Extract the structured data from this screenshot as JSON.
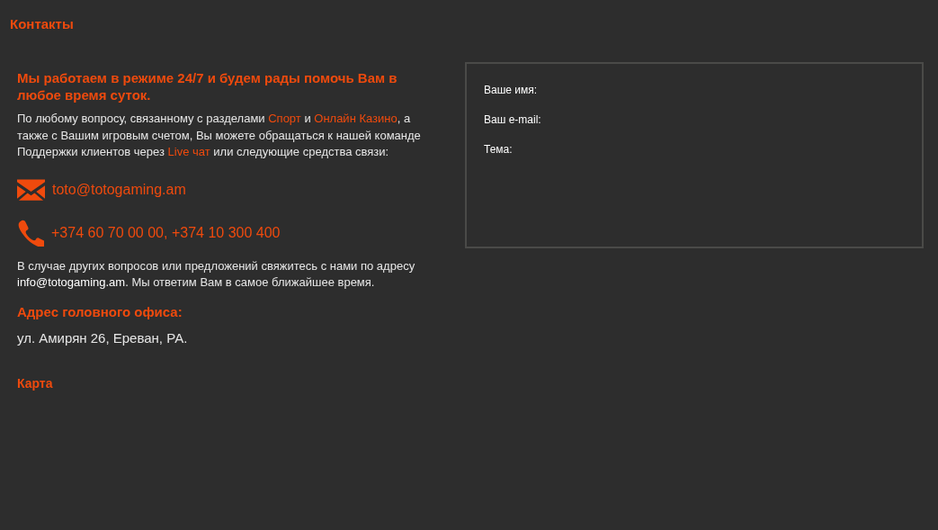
{
  "page_title": "Контакты",
  "headline": "Мы работаем в режиме 24/7 и будем рады помочь Вам в любое время суток.",
  "intro": [
    {
      "kind": "text",
      "text": "По любому вопросу, связанному с разделами "
    },
    {
      "kind": "link",
      "text": "Спорт"
    },
    {
      "kind": "text",
      "text": " и "
    },
    {
      "kind": "link",
      "text": "Онлайн Казино"
    },
    {
      "kind": "text",
      "text": ", а также с Вашим игровым счетом, Вы можете обращаться к нашей команде Поддержки клиентов через "
    },
    {
      "kind": "link",
      "text": "Live чат"
    },
    {
      "kind": "text",
      "text": " или следующие средства связи:"
    }
  ],
  "contacts": [
    {
      "kind": "email",
      "text": "toto@totogaming.am"
    },
    {
      "kind": "phone",
      "text": "+374 60 70 00 00, +374 10 300 400"
    }
  ],
  "other": [
    {
      "kind": "text",
      "text": "В случае других вопросов или предложений свяжитесь с нами по адресу "
    },
    {
      "kind": "email",
      "text": "info@totogaming.am"
    },
    {
      "kind": "text",
      "text": ". Мы ответим Вам в самое ближайшее время."
    }
  ],
  "office_heading": "Адрес головного офиса:",
  "office_address": "ул. Амирян 26, Ереван, РА.",
  "map_link": "Карта",
  "form": {
    "fields": [
      "Ваше имя:",
      "Ваш e-mail:",
      "Тема:"
    ]
  }
}
